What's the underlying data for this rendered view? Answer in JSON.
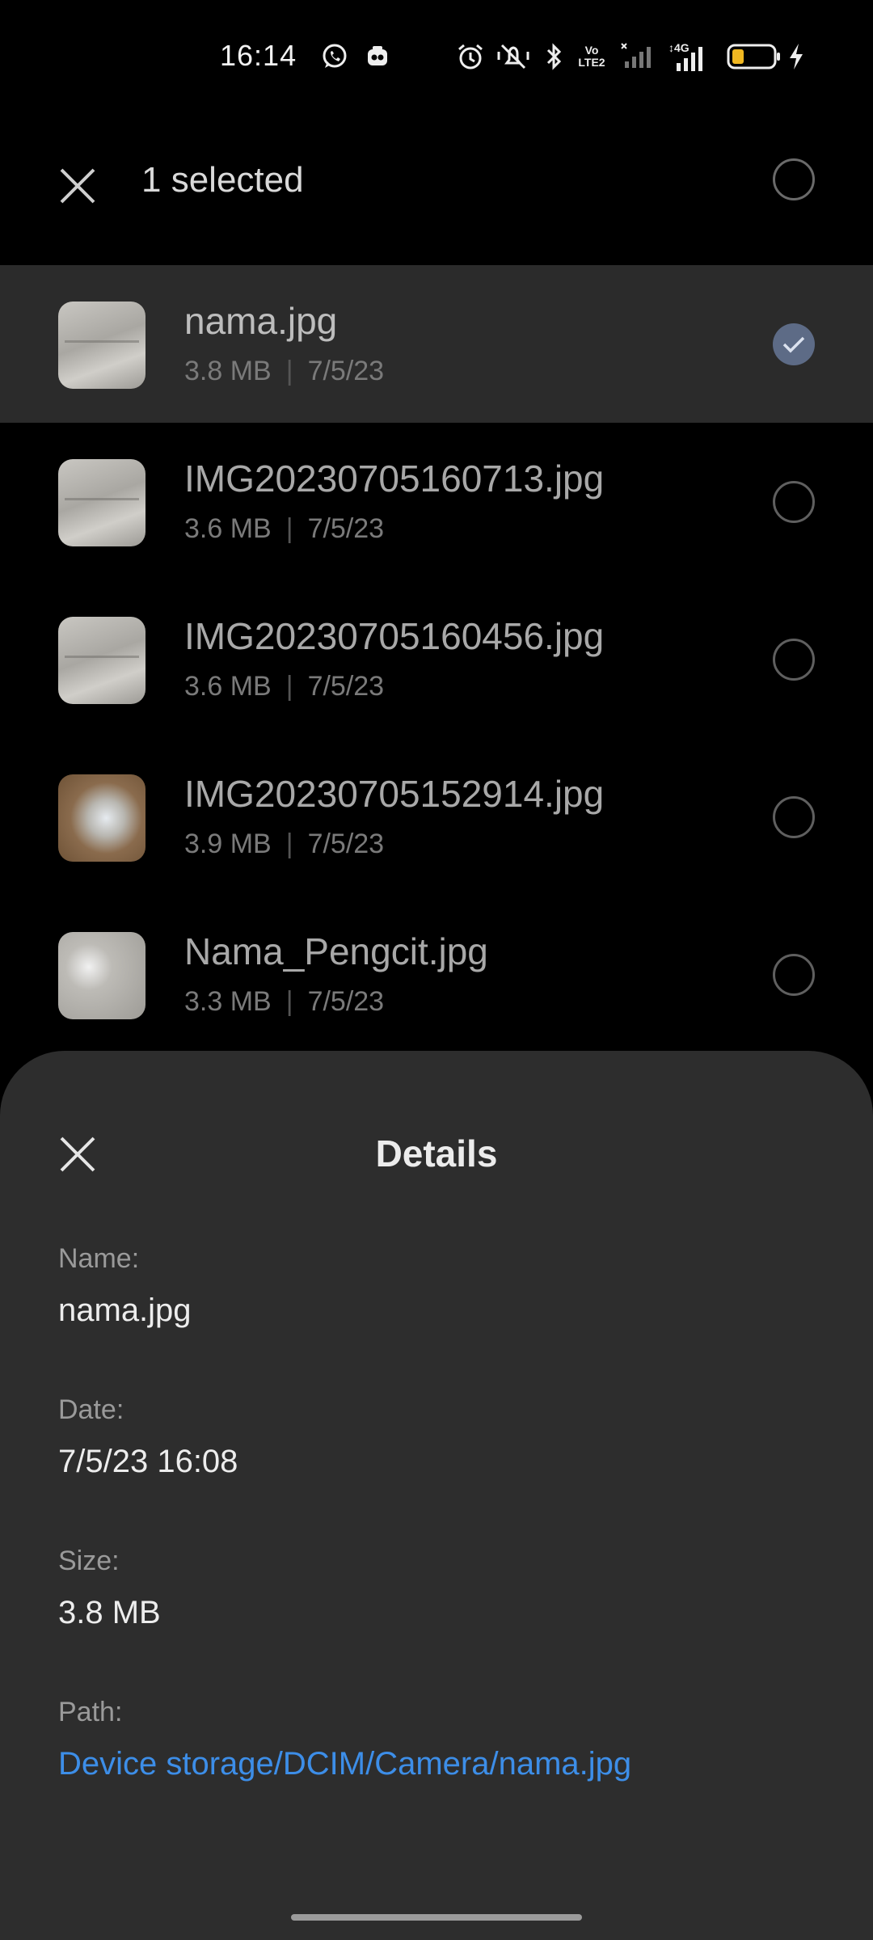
{
  "status_bar": {
    "time": "16:14",
    "icons": [
      "whatsapp-icon",
      "camera-app-icon",
      "alarm-icon",
      "mute-vibrate-icon",
      "bluetooth-icon",
      "volte-icon",
      "signal-icon",
      "4g-signal-icon",
      "battery-icon",
      "charging-icon"
    ],
    "volte_text": "Vo LTE2",
    "network_text": "4G",
    "battery_color": "#f1b821"
  },
  "header": {
    "title": "1 selected"
  },
  "files": [
    {
      "name": "nama.jpg",
      "size": "3.8 MB",
      "date": "7/5/23",
      "selected": true
    },
    {
      "name": "IMG20230705160713.jpg",
      "size": "3.6 MB",
      "date": "7/5/23",
      "selected": false
    },
    {
      "name": "IMG20230705160456.jpg",
      "size": "3.6 MB",
      "date": "7/5/23",
      "selected": false
    },
    {
      "name": "IMG20230705152914.jpg",
      "size": "3.9 MB",
      "date": "7/5/23",
      "selected": false
    },
    {
      "name": "Nama_Pengcit.jpg",
      "size": "3.3 MB",
      "date": "7/5/23",
      "selected": false
    }
  ],
  "details": {
    "title": "Details",
    "name_label": "Name:",
    "name_value": "nama.jpg",
    "date_label": "Date:",
    "date_value": "7/5/23 16:08",
    "size_label": "Size:",
    "size_value": "3.8 MB",
    "path_label": "Path:",
    "path_value": "Device storage/DCIM/Camera/nama.jpg"
  },
  "colors": {
    "background": "#000000",
    "sheet": "#2d2d2d",
    "selected_row": "#2b2b2b",
    "link": "#3d8ee8",
    "check_fill": "#5d6b86"
  }
}
